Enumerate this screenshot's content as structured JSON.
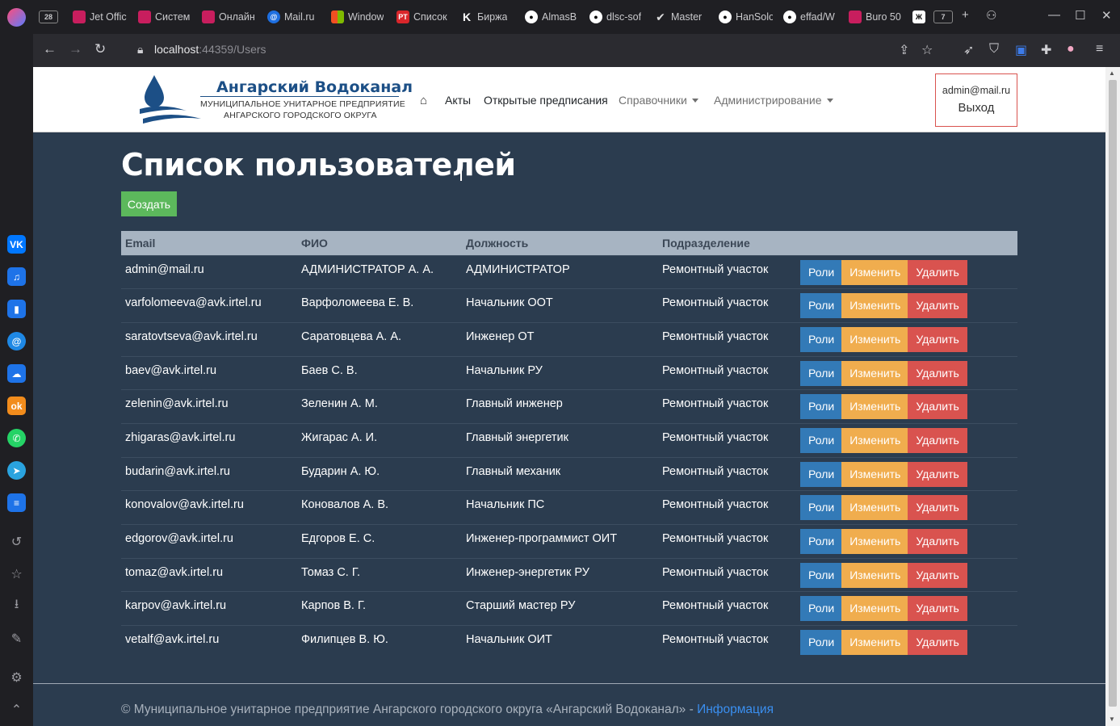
{
  "browser": {
    "tabs": [
      {
        "label": "28",
        "color": "#555"
      },
      {
        "label": "Jet Offic",
        "color": "#c81e5e"
      },
      {
        "label": "Систем",
        "color": "#c81e5e"
      },
      {
        "label": "Онлайн",
        "color": "#c81e5e"
      },
      {
        "label": "Mail.ru",
        "color": "#1e6fe0"
      },
      {
        "label": "Window",
        "color": "#f25022"
      },
      {
        "label": "Список",
        "color": "#d9262b"
      },
      {
        "label": "Биржа",
        "color": "#222"
      },
      {
        "label": "AlmasB",
        "color": "#222"
      },
      {
        "label": "dlsc-sof",
        "color": "#222"
      },
      {
        "label": "Master",
        "color": "#222"
      },
      {
        "label": "HanSolo",
        "color": "#222"
      },
      {
        "label": "effad/W",
        "color": "#222"
      },
      {
        "label": "Buro 50",
        "color": "#c81e5e"
      }
    ],
    "tab_count": "7",
    "url_host": "localhost",
    "url_rest": ":44359/Users"
  },
  "header": {
    "logo_name": "Ангарский Водоканал",
    "logo_sub1": "МУНИЦИПАЛЬНОЕ УНИТАРНОЕ ПРЕДПРИЯТИЕ",
    "logo_sub2": "АНГАРСКОГО ГОРОДСКОГО ОКРУГА",
    "nav": {
      "acts": "Акты",
      "open": "Открытые предписания",
      "refs": "Справочники",
      "admin": "Администрирование"
    },
    "user_email": "admin@mail.ru",
    "logout": "Выход"
  },
  "main": {
    "title": "Список пользователей",
    "create_label": "Создать",
    "columns": [
      "Email",
      "ФИО",
      "Должность",
      "Подразделение"
    ],
    "actions": {
      "roles": "Роли",
      "edit": "Изменить",
      "delete": "Удалить"
    },
    "users": [
      [
        "admin@mail.ru",
        "АДМИНИСТРАТОР А. А.",
        "АДМИНИСТРАТОР",
        "Ремонтный участок"
      ],
      [
        "varfolomeeva@avk.irtel.ru",
        "Варфоломеева Е. В.",
        "Начальник ООТ",
        "Ремонтный участок"
      ],
      [
        "saratovtseva@avk.irtel.ru",
        "Саратовцева А. А.",
        "Инженер ОТ",
        "Ремонтный участок"
      ],
      [
        "baev@avk.irtel.ru",
        "Баев С. В.",
        "Начальник РУ",
        "Ремонтный участок"
      ],
      [
        "zelenin@avk.irtel.ru",
        "Зеленин А. М.",
        "Главный инженер",
        "Ремонтный участок"
      ],
      [
        "zhigaras@avk.irtel.ru",
        "Жигарас А. И.",
        "Главный энергетик",
        "Ремонтный участок"
      ],
      [
        "budarin@avk.irtel.ru",
        "Бударин А. Ю.",
        "Главный механик",
        "Ремонтный участок"
      ],
      [
        "konovalov@avk.irtel.ru",
        "Коновалов А. В.",
        "Начальник ПС",
        "Ремонтный участок"
      ],
      [
        "edgorov@avk.irtel.ru",
        "Едгоров Е. С.",
        "Инженер-программист ОИТ",
        "Ремонтный участок"
      ],
      [
        "tomaz@avk.irtel.ru",
        "Томаз С. Г.",
        "Инженер-энергетик РУ",
        "Ремонтный участок"
      ],
      [
        "karpov@avk.irtel.ru",
        "Карпов В. Г.",
        "Старший мастер РУ",
        "Ремонтный участок"
      ],
      [
        "vetalf@avk.irtel.ru",
        "Филипцев В. Ю.",
        "Начальник ОИТ",
        "Ремонтный участок"
      ]
    ]
  },
  "footer": {
    "text": "© Муниципальное унитарное предприятие Ангарского городского округа «Ангарский Водоканал» - ",
    "link": "Информация"
  }
}
